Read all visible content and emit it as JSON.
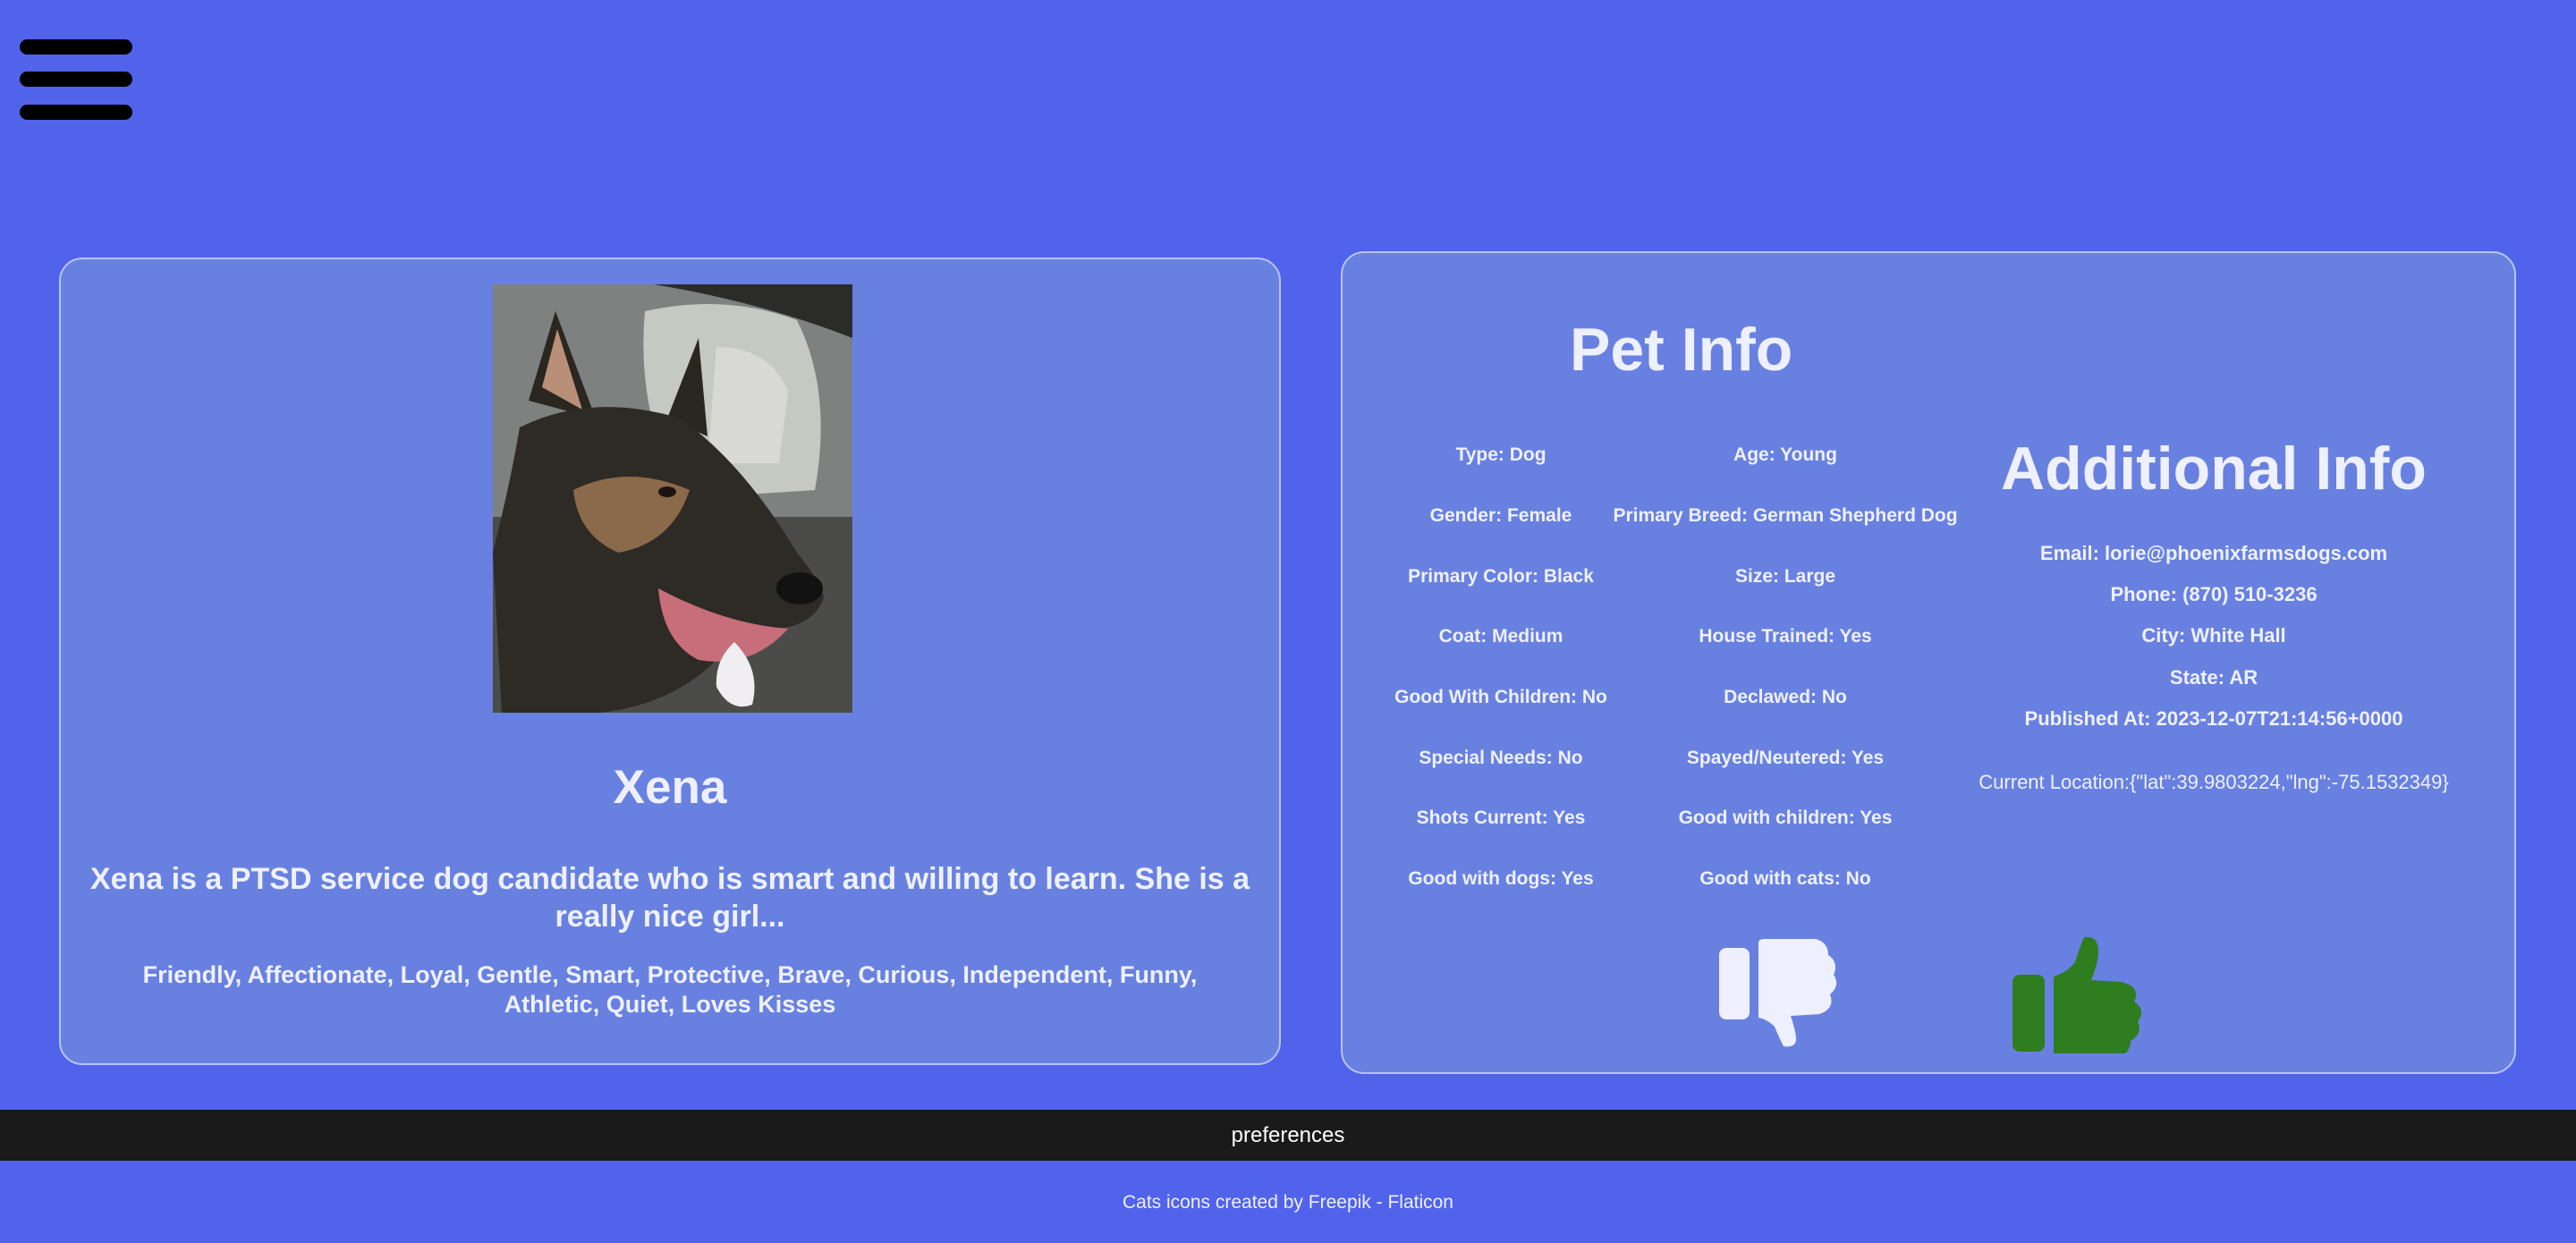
{
  "nav": {
    "menu_icon": "hamburger-icon"
  },
  "pet": {
    "name": "Xena",
    "description": "Xena is a PTSD service dog candidate who is smart and willing to learn. She is a really nice girl...",
    "traits": "Friendly, Affectionate, Loyal, Gentle, Smart, Protective, Brave, Curious, Independent, Funny, Athletic, Quiet, Loves Kisses"
  },
  "pet_info": {
    "title": "Pet Info",
    "fields": [
      "Type: Dog",
      "Age: Young",
      "Gender: Female",
      "Primary Breed: German Shepherd Dog",
      "Primary Color: Black",
      "Size: Large",
      "Coat: Medium",
      "House Trained: Yes",
      "Good With Children: No",
      "Declawed: No",
      "Special Needs: No",
      "Spayed/Neutered: Yes",
      "Shots Current: Yes",
      "Good with children: Yes",
      "Good with dogs: Yes",
      "Good with cats: No"
    ]
  },
  "additional_info": {
    "title": "Additional Info",
    "email": "Email: lorie@phoenixfarmsdogs.com",
    "phone": "Phone: (870) 510-3236",
    "city": "City: White Hall",
    "state": "State: AR",
    "published": "Published At: 2023-12-07T21:14:56+0000",
    "location": "Current Location:{\"lat\":39.9803224,\"lng\":-75.1532349}"
  },
  "actions": {
    "dislike_icon": "thumbs-down-icon",
    "like_icon": "thumbs-up-icon",
    "like_color": "#2e7d1f"
  },
  "footer": {
    "preferences_label": "preferences",
    "credit": "Cats icons created by Freepik - Flaticon"
  }
}
